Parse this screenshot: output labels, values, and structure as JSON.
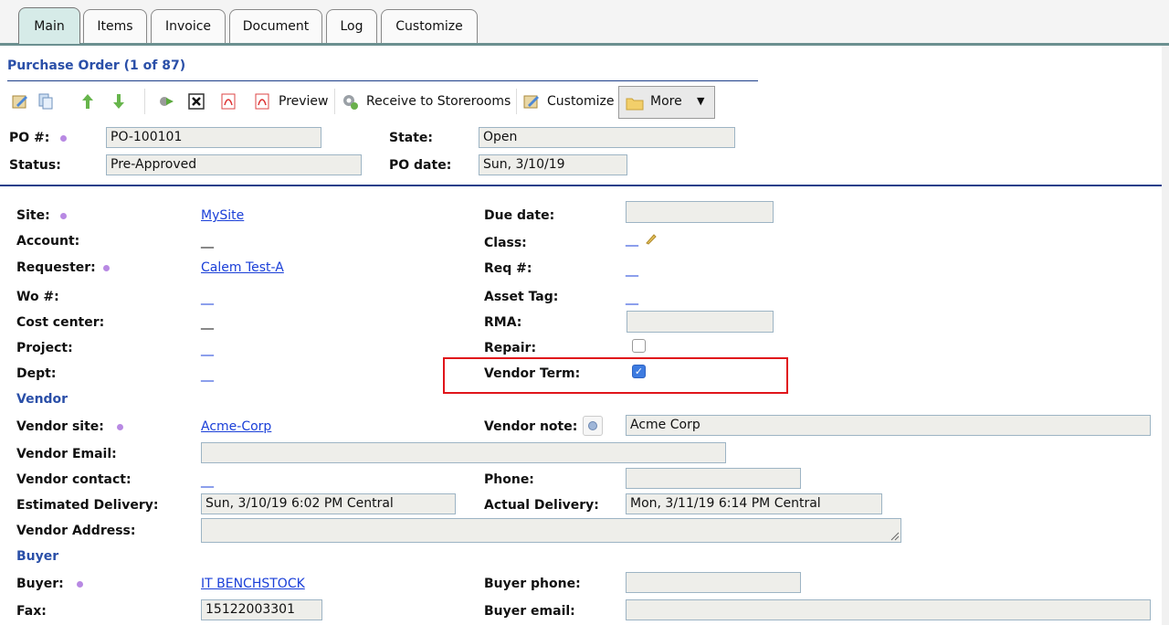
{
  "tabs": [
    "Main",
    "Items",
    "Invoice",
    "Document",
    "Log",
    "Customize"
  ],
  "header": {
    "title": "Purchase Order (1 of 87)"
  },
  "toolbar": {
    "preview": "Preview",
    "receive": "Receive to Storerooms",
    "customize": "Customize",
    "more": "More"
  },
  "summary": {
    "po_label": "PO #:",
    "po_value": "PO-100101",
    "state_label": "State:",
    "state_value": "Open",
    "status_label": "Status:",
    "status_value": "Pre-Approved",
    "po_date_label": "PO date:",
    "po_date_value": "Sun, 3/10/19"
  },
  "main": {
    "site_label": "Site:",
    "site_value": "MySite",
    "account_label": "Account:",
    "requester_label": "Requester:",
    "requester_value": "Calem Test-A",
    "wo_label": "Wo #:",
    "cost_center_label": "Cost center:",
    "project_label": "Project:",
    "dept_label": "Dept:",
    "due_date_label": "Due date:",
    "class_label": "Class:",
    "req_label": "Req #:",
    "asset_tag_label": "Asset Tag:",
    "rma_label": "RMA:",
    "repair_label": "Repair:",
    "vendor_term_label": "Vendor Term:",
    "empty_dash": "__"
  },
  "vendor": {
    "section": "Vendor",
    "site_label": "Vendor site:",
    "site_value": "Acme-Corp",
    "note_label": "Vendor note:",
    "note_value": "Acme Corp",
    "email_label": "Vendor Email:",
    "contact_label": "Vendor contact:",
    "phone_label": "Phone:",
    "est_label": "Estimated Delivery:",
    "est_value": "Sun, 3/10/19 6:02 PM Central",
    "actual_label": "Actual Delivery:",
    "actual_value": "Mon, 3/11/19 6:14 PM Central",
    "address_label": "Vendor Address:"
  },
  "buyer": {
    "section": "Buyer",
    "buyer_label": "Buyer:",
    "buyer_value": "IT BENCHSTOCK",
    "phone_label": "Buyer phone:",
    "fax_label": "Fax:",
    "fax_value": "15122003301",
    "email_label": "Buyer email:"
  },
  "colors": {
    "accent": "#2a4fa8",
    "link": "#1a3fd8",
    "highlight": "#e0151b"
  }
}
